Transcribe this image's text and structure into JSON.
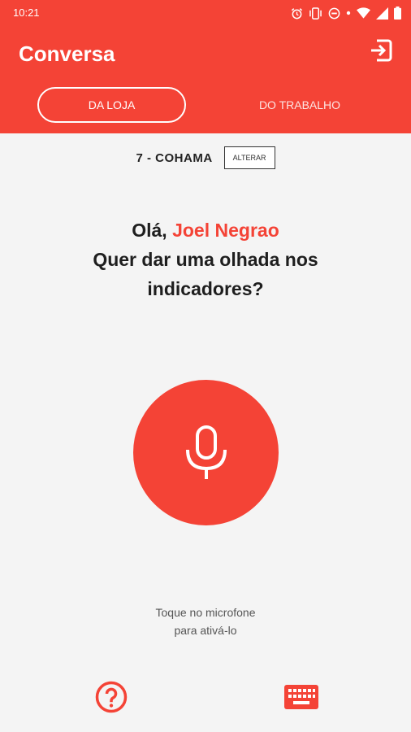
{
  "status_bar": {
    "time": "10:21",
    "icons": [
      "alarm-icon",
      "vibrate-icon",
      "dnd-icon",
      "dot-icon",
      "wifi-icon",
      "signal-icon",
      "battery-icon"
    ]
  },
  "app_bar": {
    "title": "Conversa",
    "exit_icon": "exit-icon",
    "tabs": [
      {
        "label": "DA LOJA",
        "active": true
      },
      {
        "label": "DO TRABALHO",
        "active": false
      }
    ]
  },
  "store": {
    "name": "7 - COHAMA",
    "change_label": "ALTERAR"
  },
  "greeting": {
    "prefix": "Olá, ",
    "user_name": "Joel Negrao",
    "line2": "Quer dar uma olhada nos",
    "line3": "indicadores?"
  },
  "mic": {
    "icon": "microphone-icon"
  },
  "hint": {
    "line1": "Toque no microfone",
    "line2": "para ativá-lo"
  },
  "bottom": {
    "help_icon": "help-icon",
    "keyboard_icon": "keyboard-icon"
  },
  "colors": {
    "accent": "#f44336",
    "background": "#f4f4f4",
    "text": "#1e1e1e"
  }
}
